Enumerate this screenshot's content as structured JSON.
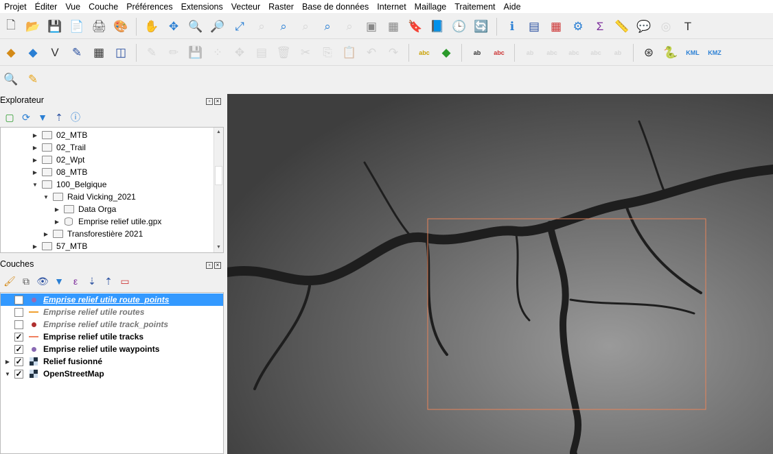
{
  "menu": [
    "Projet",
    "Éditer",
    "Vue",
    "Couche",
    "Préférences",
    "Extensions",
    "Vecteur",
    "Raster",
    "Base de données",
    "Internet",
    "Maillage",
    "Traitement",
    "Aide"
  ],
  "toolbar1": [
    [
      "new-project",
      "🗋",
      "#555"
    ],
    [
      "open-project",
      "📂",
      "#e8a317"
    ],
    [
      "save-project",
      "💾",
      "#3a5fa0"
    ],
    [
      "save-as",
      "📄",
      "#d4a017"
    ],
    [
      "print-layout",
      "🖨",
      "#555"
    ],
    [
      "style-manager",
      "🎨",
      "#c33"
    ],
    "|",
    [
      "pan",
      "✋",
      "#333"
    ],
    [
      "pan-to-selection",
      "✥",
      "#2a7fd4"
    ],
    [
      "zoom-in",
      "🔍",
      "#2a7fd4"
    ],
    [
      "zoom-out",
      "🔎",
      "#2a7fd4"
    ],
    [
      "zoom-full",
      "⤢",
      "#2a7fd4"
    ],
    [
      "zoom-to-selection",
      "⌕",
      "#aaa"
    ],
    [
      "zoom-to-layer",
      "⌕",
      "#2a7fd4"
    ],
    [
      "zoom-native",
      "⌕",
      "#aaa"
    ],
    [
      "zoom-last",
      "⌕",
      "#2a7fd4"
    ],
    [
      "zoom-next",
      "⌕",
      "#aaa"
    ],
    [
      "new-map-view",
      "▣",
      "#888"
    ],
    [
      "new-3d-view",
      "▦",
      "#888"
    ],
    [
      "bookmark",
      "🔖",
      "#2a50a0"
    ],
    [
      "show-bookmarks",
      "📘",
      "#2a50a0"
    ],
    [
      "temporal",
      "🕒",
      "#555"
    ],
    [
      "refresh",
      "🔄",
      "#2a7fd4"
    ],
    "|",
    [
      "identify",
      "ℹ",
      "#2a7fd4"
    ],
    [
      "attribute-table",
      "▤",
      "#2a50a0"
    ],
    [
      "field-calculator",
      "▦",
      "#c33"
    ],
    [
      "processing",
      "⚙",
      "#2a7fd4"
    ],
    [
      "statistics",
      "Σ",
      "#7a2a9a"
    ],
    [
      "measure",
      "📏",
      "#333"
    ],
    [
      "annotation",
      "💬",
      "#e8c317"
    ],
    [
      "map-tips",
      "◎",
      "#aaa"
    ],
    [
      "text-annotation",
      "T",
      "#333"
    ]
  ],
  "toolbar2": [
    [
      "add-layer",
      "◆",
      "#d48a17"
    ],
    [
      "data-source",
      "◆",
      "#2a7fd4"
    ],
    [
      "digitize",
      "V",
      "#333"
    ],
    [
      "editing",
      "✎",
      "#2a50a0"
    ],
    [
      "gps",
      "▦",
      "#333"
    ],
    [
      "vertex-tool",
      "◫",
      "#2a50a0"
    ],
    "|",
    [
      "edit-pencil",
      "✎",
      "#aaa"
    ],
    [
      "toggle-edit",
      "✏",
      "#aaa"
    ],
    [
      "save-edits",
      "💾",
      "#aaa"
    ],
    [
      "add-feature",
      "⁘",
      "#aaa"
    ],
    [
      "move-feature",
      "✥",
      "#aaa"
    ],
    [
      "node-tool",
      "▤",
      "#aaa"
    ],
    [
      "delete",
      "🗑",
      "#aaa"
    ],
    [
      "cut",
      "✂",
      "#aaa"
    ],
    [
      "copy",
      "⎘",
      "#aaa"
    ],
    [
      "paste",
      "📋",
      "#aaa"
    ],
    [
      "undo",
      "↶",
      "#aaa"
    ],
    [
      "redo",
      "↷",
      "#aaa"
    ],
    "|",
    [
      "label-abc",
      "abc",
      "#c9a000"
    ],
    [
      "label-rules",
      "◆",
      "#2a9a2a"
    ],
    "|",
    [
      "label-pin",
      "ab",
      "#333"
    ],
    [
      "label-highlight",
      "abc",
      "#c33"
    ],
    "|",
    [
      "label-move",
      "ab",
      "#aaa"
    ],
    [
      "label-show",
      "abc",
      "#aaa"
    ],
    [
      "label-rotate",
      "abc",
      "#aaa"
    ],
    [
      "label-change",
      "abc",
      "#aaa"
    ],
    [
      "label-edit",
      "ab",
      "#aaa"
    ],
    "|",
    [
      "osm-plugin",
      "⊛",
      "#333"
    ],
    [
      "python",
      "🐍",
      "#2a50a0"
    ],
    [
      "kml",
      "KML",
      "#2a7fd4"
    ],
    [
      "kmz",
      "KMZ",
      "#2a7fd4"
    ]
  ],
  "toolbar3": [
    [
      "locator",
      "🔍",
      "#2a9a2a"
    ],
    [
      "plugin-tool",
      "✎",
      "#e8a317"
    ]
  ],
  "explorer": {
    "title": "Explorateur",
    "items": [
      {
        "label": "02_MTB",
        "depth": 0,
        "expand": "closed",
        "type": "folder"
      },
      {
        "label": "02_Trail",
        "depth": 0,
        "expand": "closed",
        "type": "folder"
      },
      {
        "label": "02_Wpt",
        "depth": 0,
        "expand": "closed",
        "type": "folder"
      },
      {
        "label": "08_MTB",
        "depth": 0,
        "expand": "closed",
        "type": "folder"
      },
      {
        "label": "100_Belgique",
        "depth": 0,
        "expand": "open",
        "type": "folder"
      },
      {
        "label": "Raid Vicking_2021",
        "depth": 1,
        "expand": "open",
        "type": "folder"
      },
      {
        "label": "Data Orga",
        "depth": 2,
        "expand": "closed",
        "type": "folder"
      },
      {
        "label": "Emprise relief utile.gpx",
        "depth": 2,
        "expand": "closed",
        "type": "db"
      },
      {
        "label": "Transforestière 2021",
        "depth": 1,
        "expand": "closed",
        "type": "folder"
      },
      {
        "label": "57_MTB",
        "depth": 0,
        "expand": "closed",
        "type": "folder"
      }
    ]
  },
  "layers": {
    "title": "Couches",
    "items": [
      {
        "label": "Emprise relief utile route_points",
        "checked": false,
        "symbol": "dot",
        "color": "#9a6ab4",
        "style": "selected"
      },
      {
        "label": "Emprise relief utile routes",
        "checked": false,
        "symbol": "line",
        "color": "#f0a030",
        "style": "hidden"
      },
      {
        "label": "Emprise relief utile track_points",
        "checked": false,
        "symbol": "dot",
        "color": "#b03030",
        "style": "hidden"
      },
      {
        "label": "Emprise relief utile tracks",
        "checked": true,
        "symbol": "line",
        "color": "#f08060",
        "style": "visible"
      },
      {
        "label": "Emprise relief utile waypoints",
        "checked": true,
        "symbol": "dot",
        "color": "#8a6ab4",
        "style": "visible"
      },
      {
        "label": "Relief fusionné",
        "checked": true,
        "symbol": "raster",
        "color": "#234",
        "style": "visible",
        "expand": "closed"
      },
      {
        "label": "OpenStreetMap",
        "checked": true,
        "symbol": "raster",
        "color": "#234",
        "style": "visible",
        "expand": "open"
      }
    ]
  },
  "colors": {
    "extent_rect": "#e8845a",
    "selection": "#3399ff"
  }
}
